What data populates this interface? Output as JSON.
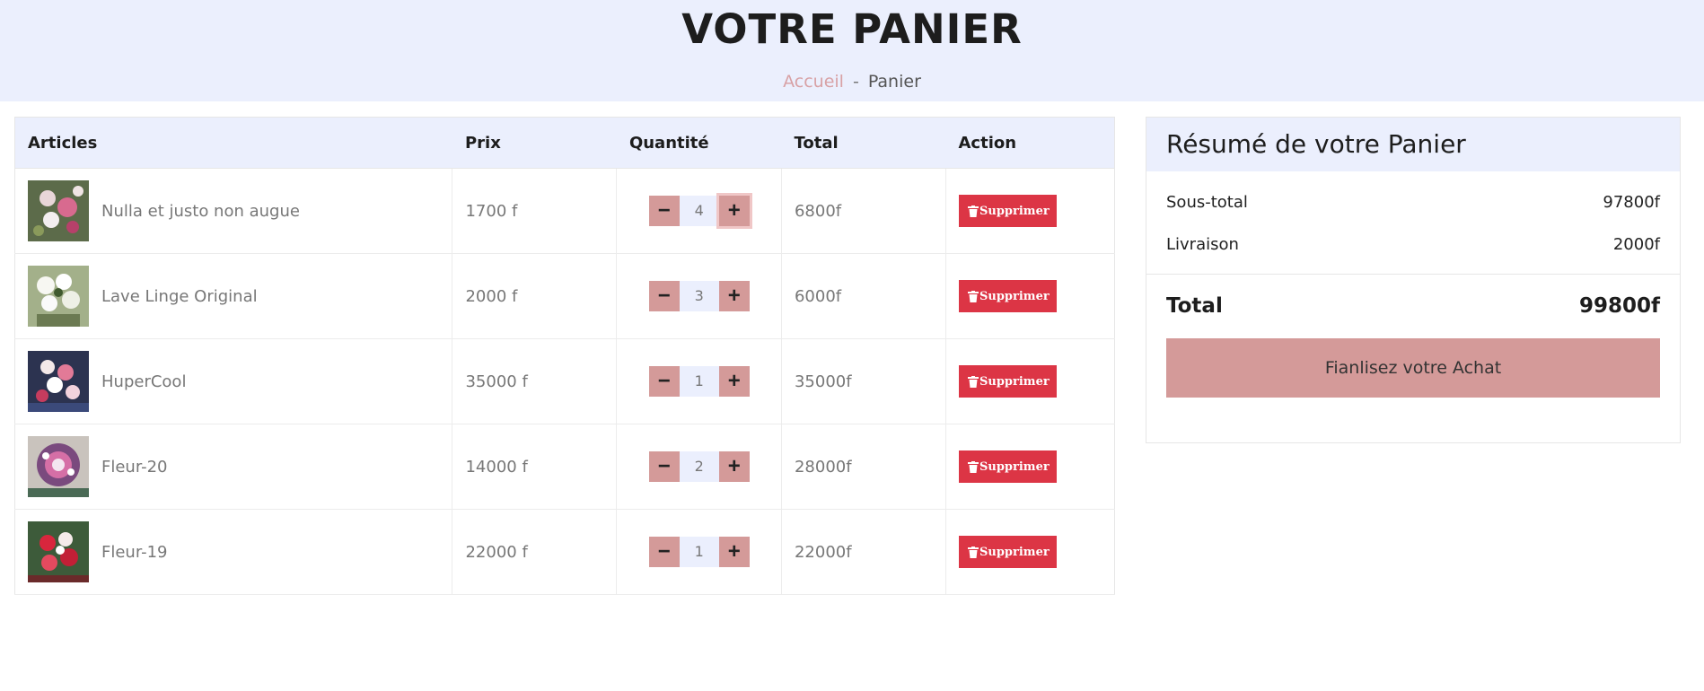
{
  "header": {
    "title": "VOTRE PANIER",
    "breadcrumb": {
      "home": "Accueil",
      "separator": "-",
      "current": "Panier"
    }
  },
  "table": {
    "columns": {
      "articles": "Articles",
      "prix": "Prix",
      "quantite": "Quantité",
      "total": "Total",
      "action": "Action"
    },
    "rows": [
      {
        "name": "Nulla et justo non augue",
        "price": "1700 f",
        "qty": "4",
        "total": "6800f",
        "delete": "Supprimer"
      },
      {
        "name": "Lave Linge Original",
        "price": "2000 f",
        "qty": "3",
        "total": "6000f",
        "delete": "Supprimer"
      },
      {
        "name": "HuperCool",
        "price": "35000 f",
        "qty": "1",
        "total": "35000f",
        "delete": "Supprimer"
      },
      {
        "name": "Fleur-20",
        "price": "14000 f",
        "qty": "2",
        "total": "28000f",
        "delete": "Supprimer"
      },
      {
        "name": "Fleur-19",
        "price": "22000 f",
        "qty": "1",
        "total": "22000f",
        "delete": "Supprimer"
      }
    ],
    "icons": {
      "decrease": "minus-icon",
      "increase": "plus-icon",
      "delete": "trash-icon"
    }
  },
  "summary": {
    "title": "Résumé de votre Panier",
    "subtotal_label": "Sous-total",
    "subtotal_value": "97800f",
    "shipping_label": "Livraison",
    "shipping_value": "2000f",
    "total_label": "Total",
    "total_value": "99800f",
    "checkout_label": "Fianlisez votre Achat"
  },
  "colors": {
    "accent": "#d49a99",
    "header_bg": "#ebeffd",
    "danger": "#dc3545",
    "breadcrumb_link": "#d8a1a5"
  }
}
